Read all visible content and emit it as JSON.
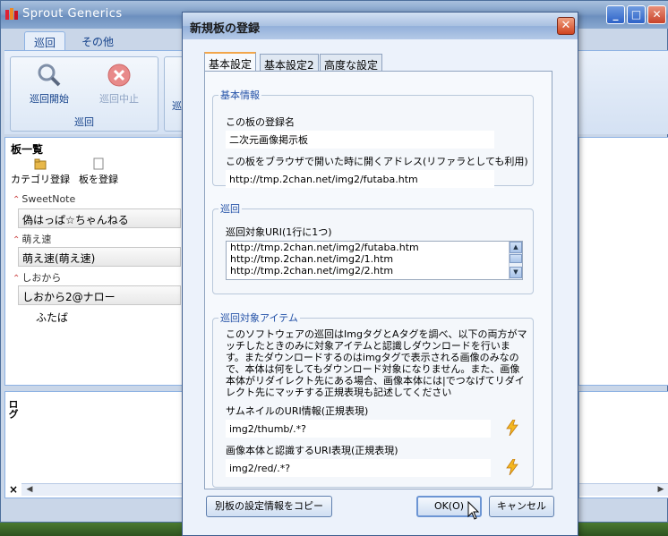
{
  "app": {
    "title": "Sprout Generics",
    "colors": {
      "title_bar": "#7f9fc8",
      "accent": "#2452a8",
      "close": "#d04420"
    }
  },
  "ribbon": {
    "tabs": [
      {
        "label": "巡回"
      },
      {
        "label": "その他"
      }
    ],
    "buttons": {
      "start": "巡回開始",
      "stop": "巡回中止"
    },
    "group_label": "巡回",
    "stub_label": "巡"
  },
  "board_panel": {
    "title": "板一覧",
    "toolbar": {
      "register_category": "カテゴリ登録",
      "register_board": "板を登録"
    },
    "categories": [
      {
        "name": "SweetNote",
        "boards": [
          "偽はっぱ☆ちゃんねる"
        ]
      },
      {
        "name": "萌え速",
        "boards": [
          "萌え速(萌え速)"
        ]
      },
      {
        "name": "しおから",
        "boards": [
          "しおから2@ナロー"
        ]
      }
    ],
    "extra_item": "ふたば"
  },
  "log_panel": {
    "label": "ログ",
    "close": "×"
  },
  "dialog": {
    "title": "新規板の登録",
    "close": "✕",
    "tabs": [
      {
        "label": "基本設定"
      },
      {
        "label": "基本設定2"
      },
      {
        "label": "高度な設定"
      }
    ],
    "basic_info": {
      "legend": "基本情報",
      "name_label": "この板の登録名",
      "name_value": "二次元画像掲示板",
      "url_label": "この板をブラウザで開いた時に開くアドレス(リファラとしても利用)",
      "url_value": "http://tmp.2chan.net/img2/futaba.htm"
    },
    "patrol": {
      "legend": "巡回",
      "uri_label": "巡回対象URI(1行に1つ)",
      "uris": [
        "http://tmp.2chan.net/img2/futaba.htm",
        "http://tmp.2chan.net/img2/1.htm",
        "http://tmp.2chan.net/img2/2.htm"
      ]
    },
    "patrol_items": {
      "legend": "巡回対象アイテム",
      "description": "このソフトウェアの巡回はImgタグとAタグを調べ、以下の両方がマッチしたときのみに対象アイテムと認識しダウンロードを行います。またダウンロードするのはimgタグで表示される画像のみなので、本体は何をしてもダウンロード対象になりません。また、画像本体がリダイレクト先にある場合、画像本体には|でつなげてリダイレクト先にマッチする正規表現も記述してください",
      "thumb_label": "サムネイルのURI情報(正規表現)",
      "thumb_value": "img2/thumb/.*?",
      "image_label": "画像本体と認識するURI表現(正規表現)",
      "image_value": "img2/red/.*?"
    },
    "buttons": {
      "copy": "別板の設定情報をコピー",
      "ok": "OK(O)",
      "cancel": "キャンセル"
    }
  }
}
